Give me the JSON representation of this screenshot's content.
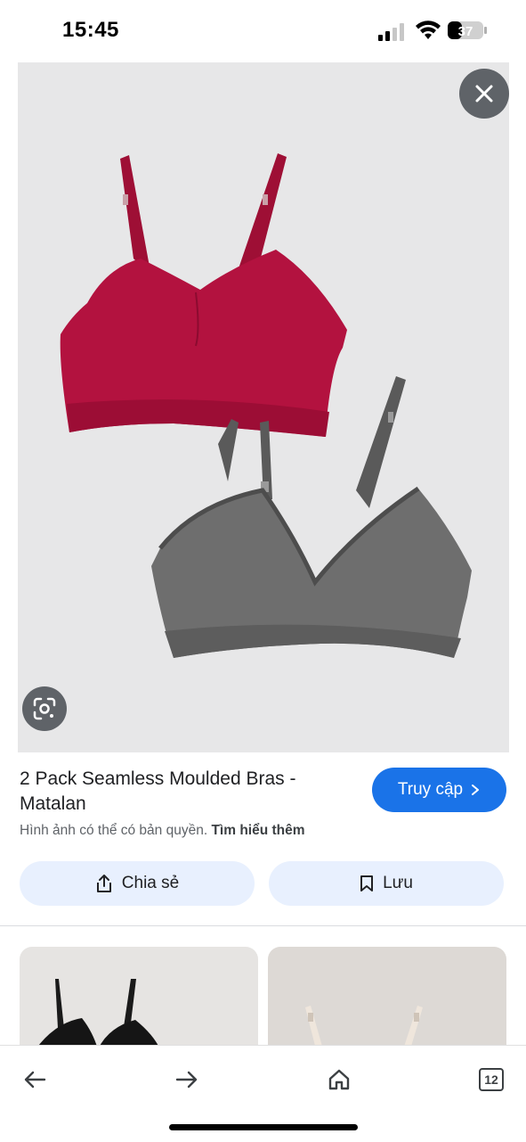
{
  "status": {
    "time": "15:45",
    "battery": "37"
  },
  "result": {
    "title": "2 Pack Seamless Moulded Bras - Matalan",
    "visit_label": "Truy cập",
    "copyright_text": "Hình ảnh có thể có bản quyền.",
    "learn_more": "Tìm hiểu thêm"
  },
  "actions": {
    "share_label": "Chia sẻ",
    "save_label": "Lưu"
  },
  "bottom_nav": {
    "tabs_count": "12"
  },
  "colors": {
    "accent": "#1a73e8",
    "pill_bg": "#e8f0fe",
    "hero_bg": "#e7e7e8",
    "red_bra": "#b3123f",
    "grey_bra": "#6e6e6e"
  },
  "icons": [
    "signal-icon",
    "wifi-icon",
    "battery-icon",
    "close-icon",
    "lens-icon",
    "chevron-right-icon",
    "share-icon",
    "bookmark-icon",
    "back-arrow-icon",
    "forward-arrow-icon",
    "home-icon",
    "tabs-icon"
  ]
}
